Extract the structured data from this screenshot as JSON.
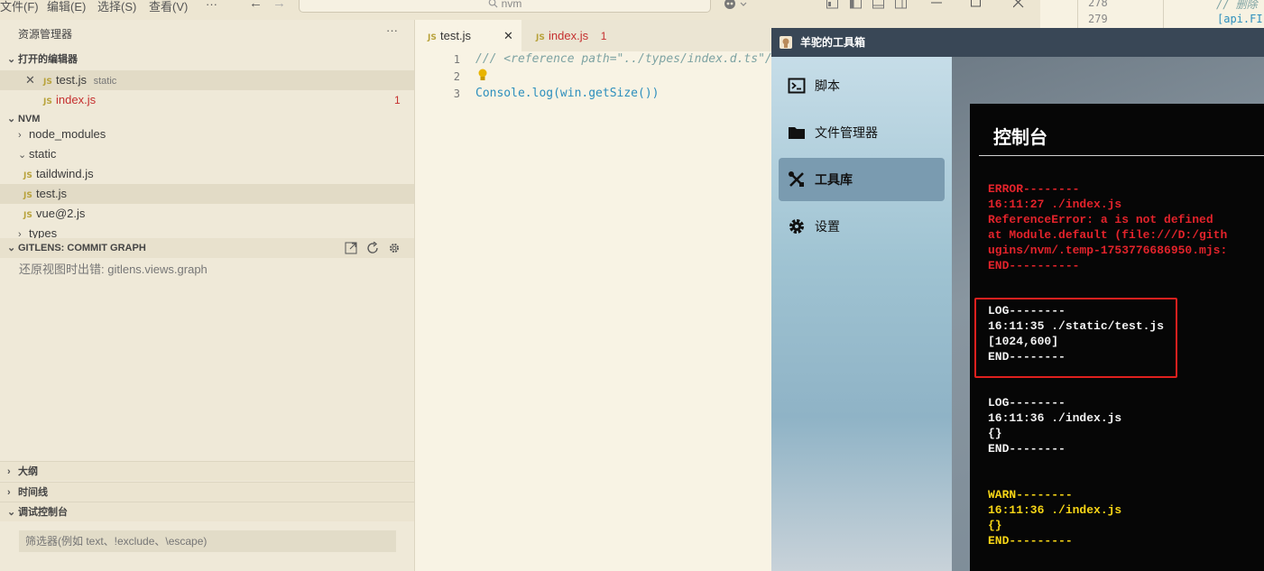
{
  "menubar": {
    "items": [
      "文件(F)",
      "编辑(E)",
      "选择(S)",
      "查看(V)",
      "···"
    ],
    "nav_back": "←",
    "nav_forward": "→",
    "search_text": "nvm"
  },
  "sidebar": {
    "title": "资源管理器",
    "more": "···",
    "open_editors": {
      "header": "打开的编辑器",
      "files": [
        {
          "name": "test.js",
          "folder": "static",
          "badge": ""
        },
        {
          "name": "index.js",
          "folder": "",
          "badge": "1"
        }
      ]
    },
    "project": {
      "header": "NVM",
      "items": [
        {
          "label": "node_modules",
          "type": "folder"
        },
        {
          "label": "static",
          "type": "folder"
        },
        {
          "label": "taildwind.js",
          "type": "file"
        },
        {
          "label": "test.js",
          "type": "file"
        },
        {
          "label": "vue@2.js",
          "type": "file"
        },
        {
          "label": "types",
          "type": "folder"
        }
      ]
    },
    "gitlens": {
      "header": "GITLENS: COMMIT GRAPH",
      "message": "还原视图时出错: gitlens.views.graph"
    },
    "outline": "大纲",
    "timeline": "时间线",
    "debug_console": "调试控制台",
    "filter_placeholder": "筛选器(例如 text、!exclude、\\escape)"
  },
  "editor": {
    "tabs": [
      {
        "label": "test.js",
        "badge": ""
      },
      {
        "label": "index.js",
        "badge": "1"
      }
    ],
    "js_badge": "JS",
    "lines": [
      {
        "number": "1",
        "text": "/// <reference path=\"../types/index.d.ts\"/>"
      },
      {
        "number": "2",
        "text": ""
      },
      {
        "number": "3",
        "text": "Console.log(win.getSize())"
      }
    ]
  },
  "background_code": {
    "lines": [
      {
        "number": "278",
        "text": "// 删除"
      },
      {
        "number": "279",
        "text": "[api.FI"
      }
    ]
  },
  "app": {
    "title": "羊驼的工具箱",
    "nav": [
      {
        "label": "脚本",
        "icon": "terminal-icon",
        "active": false
      },
      {
        "label": "文件管理器",
        "icon": "folder-icon",
        "active": false
      },
      {
        "label": "工具库",
        "icon": "tools-icon",
        "active": true
      },
      {
        "label": "设置",
        "icon": "gear-icon",
        "active": false
      }
    ],
    "console_title": "控制台",
    "logs": [
      {
        "level": "error",
        "lines": [
          "ERROR--------",
          "16:11:27 ./index.js",
          "ReferenceError: a is not defined",
          "at Module.default (file:///D:/gith",
          "ugins/nvm/.temp-1753776686950.mjs:",
          "END----------"
        ]
      },
      {
        "level": "log",
        "lines": [
          "LOG--------",
          "16:11:35 ./static/test.js",
          "[1024,600]",
          "END--------"
        ]
      },
      {
        "level": "log",
        "lines": [
          "LOG--------",
          "16:11:36 ./index.js",
          "{}",
          "END--------"
        ]
      },
      {
        "level": "warn",
        "lines": [
          "WARN--------",
          "16:11:36 ./index.js",
          "{}",
          "END---------"
        ]
      }
    ]
  },
  "colors": {
    "error": "#e3232b",
    "log": "#f2f2f2",
    "warn": "#f7d516",
    "highlight_box": "#e0201e",
    "badge_red": "#c52f2f"
  }
}
